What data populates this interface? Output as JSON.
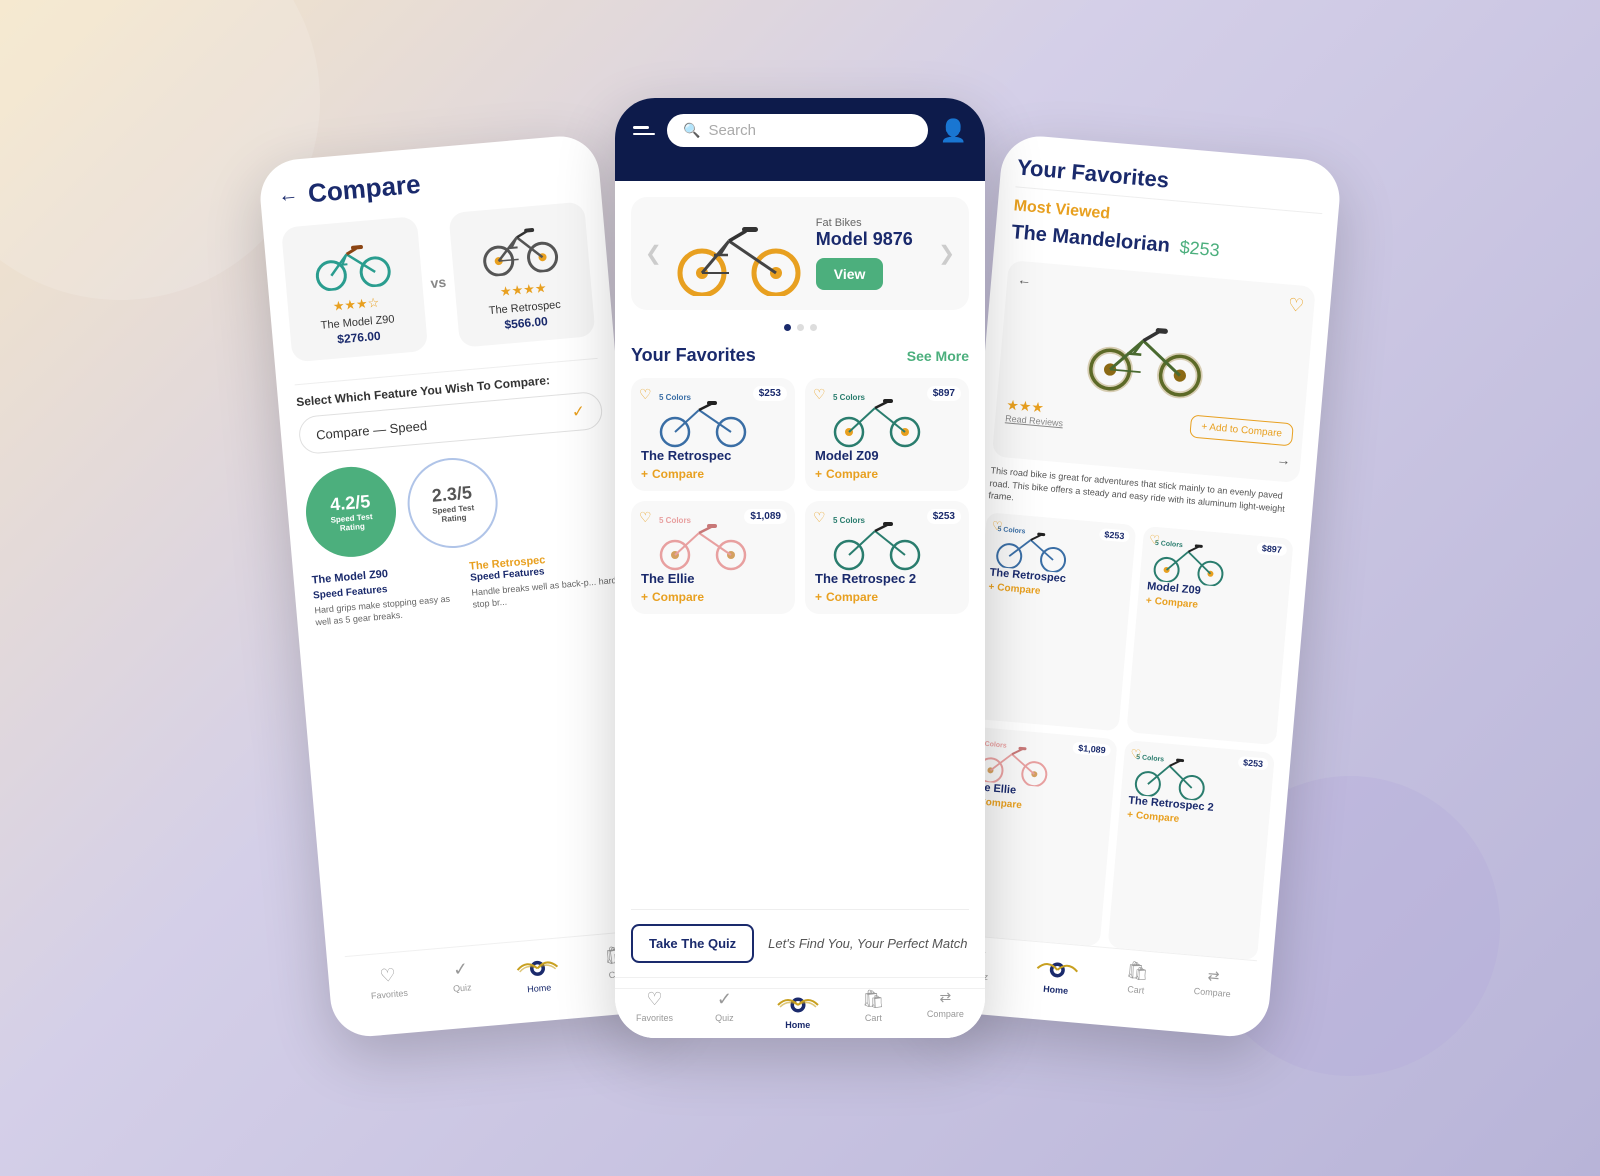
{
  "left_phone": {
    "title": "Compare",
    "back_arrow": "←",
    "bike1": {
      "emoji": "🚲",
      "stars": "★★★",
      "empty_stars": "☆",
      "name": "The Model Z90",
      "price": "$276.00"
    },
    "vs": "vs",
    "bike2": {
      "emoji": "🚴",
      "stars": "★★★★",
      "name": "The Retrospec",
      "price": "$566.00"
    },
    "feature_select_label": "Select Which Feature You Wish To Compare:",
    "dropdown_text": "Compare — Speed",
    "dropdown_check": "✓",
    "rating1": {
      "value": "4.2/5",
      "label": "Speed Test\nRating"
    },
    "rating2": {
      "value": "2.3/5",
      "label": "Speed Test\nRating"
    },
    "col1_name": "The Model Z90",
    "col1_feature": "Speed Features",
    "col1_desc": "Hard grips make stopping easy as well as 5 gear breaks.",
    "col2_name": "The Retrospec",
    "col2_feature": "Speed Features",
    "col2_desc": "Handle breaks well as back-p... hard stop br...",
    "nav": {
      "favorites": "Favorites",
      "quiz": "Quiz",
      "home": "Home",
      "cart": "Cart"
    }
  },
  "center_phone": {
    "header": {
      "search_placeholder": "Search",
      "hamburger": true
    },
    "featured_bike": {
      "category": "Fat Bikes",
      "name": "Model 9876",
      "view_btn": "View",
      "emoji": "🚲"
    },
    "carousel_active": 0,
    "carousel_total": 3,
    "favorites_section": {
      "title": "Your Favorites",
      "see_more": "See More",
      "bikes": [
        {
          "name": "The Retrospec",
          "price": "$253",
          "emoji": "🚴",
          "compare_label": "Compare"
        },
        {
          "name": "Model Z09",
          "price": "$897",
          "emoji": "🚲",
          "compare_label": "Compare"
        },
        {
          "name": "The Ellie",
          "price": "$1,089",
          "emoji": "🚲",
          "compare_label": "Compare"
        },
        {
          "name": "The Retrospec 2",
          "price": "$253",
          "emoji": "🚴",
          "compare_label": "Compare"
        }
      ]
    },
    "quiz_banner": {
      "btn": "Take The Quiz",
      "text": "Let's Find You, Your Perfect Match"
    },
    "nav": {
      "favorites": "Favorites",
      "quiz": "Quiz",
      "home": "Home",
      "cart": "Cart",
      "compare": "Compare"
    }
  },
  "right_phone": {
    "title": "Your Favorites",
    "most_viewed": "Most Viewed",
    "featured_name": "The Mandelorian",
    "featured_price": "$253",
    "featured_desc": "This road bike is great for adventures that stick mainly to an evenly paved road. This bike offers a steady and easy ride with its aluminum light-weight frame.",
    "stars": "★★★",
    "read_reviews": "Read Reviews",
    "add_compare": "+ Add to Compare",
    "heart": "♡",
    "right_arrow": "→",
    "left_arrow": "←",
    "bikes": [
      {
        "name": "The Retrospec",
        "price": "$253",
        "emoji": "🚴",
        "compare_label": "Compare"
      },
      {
        "name": "Model Z09",
        "price": "$897",
        "emoji": "🚲",
        "compare_label": "Compare"
      },
      {
        "name": "The Ellie",
        "price": "$1,089",
        "emoji": "🚲",
        "compare_label": "Compare"
      },
      {
        "name": "The Retrospec 2",
        "price": "$253",
        "emoji": "🚴",
        "compare_label": "Compare"
      }
    ],
    "nav": {
      "quiz": "Quiz",
      "home": "Home",
      "cart": "Cart",
      "compare": "Compare"
    }
  },
  "icons": {
    "heart": "♡",
    "heart_filled": "♥",
    "cart": "🛍",
    "user": "👤",
    "search": "🔍",
    "check": "✓",
    "plus": "+",
    "left_arrow": "←",
    "right_arrow": "→"
  }
}
